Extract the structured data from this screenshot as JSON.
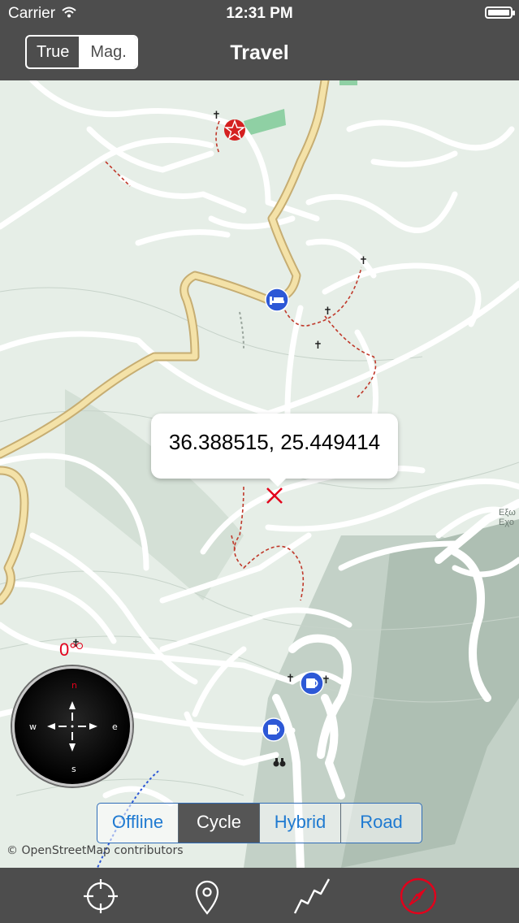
{
  "status": {
    "carrier": "Carrier",
    "time": "12:31 PM",
    "battery_level": 1.0
  },
  "navbar": {
    "title": "Travel",
    "north_options": [
      "True",
      "Mag."
    ],
    "north_selected": "Mag."
  },
  "map": {
    "callout_text": "36.388515, 25.449414",
    "heading_readout": "0°",
    "attribution": "© OpenStreetMap contributors",
    "place_label": "Εξω Εχο",
    "compass_letters": {
      "n": "n",
      "s": "s",
      "e": "e",
      "w": "w"
    },
    "map_types": [
      "Offline",
      "Cycle",
      "Hybrid",
      "Road"
    ],
    "map_type_selected": "Cycle",
    "colors": {
      "marker": "#e3001b",
      "poi_blue": "#2d58d6",
      "poi_red": "#d42020",
      "road_yellow": "#f4e2a8",
      "path_red": "#c0392b",
      "tint": "#1f7ad1"
    },
    "icons": [
      "marker-x-icon",
      "star-poi-icon",
      "hotel-poi-icon",
      "cafe-poi-icon",
      "cross-icon",
      "binoculars-icon"
    ]
  },
  "tabbar": {
    "tabs": [
      {
        "icon": "locate-icon",
        "active": false
      },
      {
        "icon": "pin-icon",
        "active": false
      },
      {
        "icon": "route-icon",
        "active": false
      },
      {
        "icon": "compass-icon",
        "active": true
      }
    ]
  }
}
